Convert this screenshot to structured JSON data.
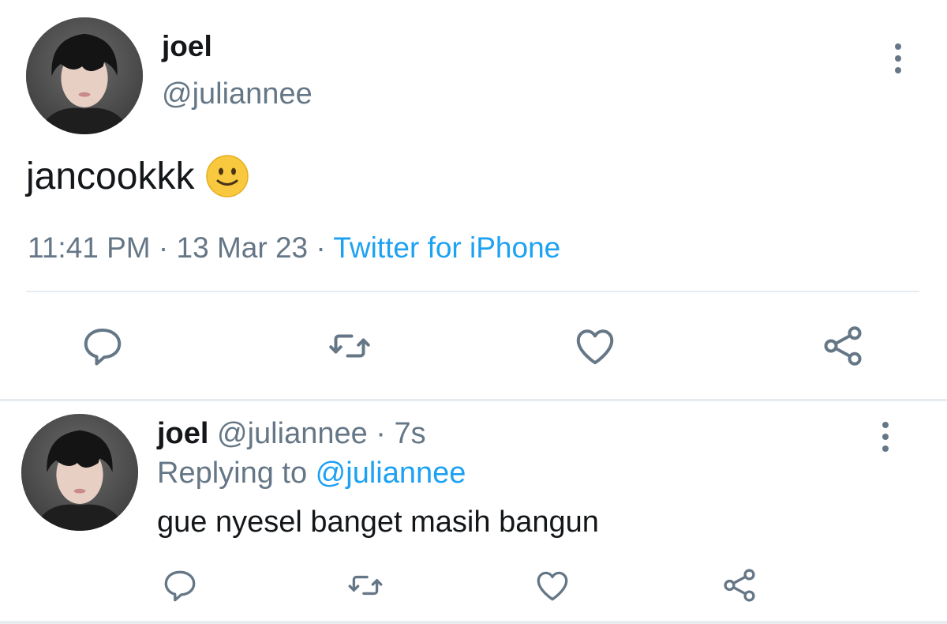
{
  "main_tweet": {
    "name": "joel",
    "handle": "@juliannee",
    "text": "jancookkk",
    "emoji": "slightly-smiling-face",
    "time": "11:41 PM",
    "sep1": " · ",
    "date": "13 Mar 23",
    "sep2": " · ",
    "source": "Twitter for iPhone"
  },
  "reply_tweet": {
    "name": "joel",
    "handle": "@juliannee",
    "time": " · 7s",
    "replying_prefix": "Replying to ",
    "replying_to": "@juliannee",
    "text": "gue nyesel banget masih bangun"
  },
  "icons": [
    "more-icon",
    "reply-icon",
    "retweet-icon",
    "like-icon",
    "share-icon"
  ],
  "colors": {
    "text": "#14171a",
    "secondary": "#657786",
    "link": "#1da1f2",
    "divider": "#e6ecf0"
  }
}
